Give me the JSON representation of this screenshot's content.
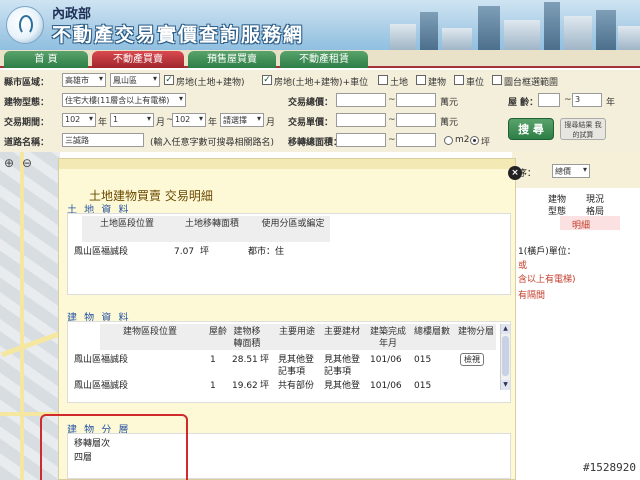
{
  "header": {
    "agency": "內政部",
    "title": "不動產交易實價查詢服務網"
  },
  "nav": {
    "tabs": [
      {
        "label": "首 頁",
        "active": false
      },
      {
        "label": "不動產買賣",
        "active": true
      },
      {
        "label": "預售屋買賣",
        "active": false
      },
      {
        "label": "不動產租賃",
        "active": false
      }
    ]
  },
  "search": {
    "area_label": "縣市區域：",
    "city": "高雄市",
    "district": "鳳山區",
    "check_land": "房地(土地+建物)",
    "check_land_car": "房地(土地+建物)+車位",
    "check_soil": "土地",
    "check_building": "建物",
    "check_car": "車位",
    "check_map": "圖台框選範圍",
    "type_label": "建物型態：",
    "type_value": "住宅大樓(11層含以上有電梯)",
    "total_price_label": "交易總價：",
    "total_unit": "萬元",
    "age_label": "屋 齡：",
    "age_from": "",
    "age_to": "3",
    "age_unit": "年",
    "date_label": "交易期間：",
    "year_from": "102",
    "month_from": "1",
    "year_to": "102",
    "month_to_placeholder": "請選擇",
    "year_unit": "年",
    "month_unit": "月",
    "unit_price_label": "交易單價：",
    "unit_price_unit": "萬元",
    "road_label": "道路名稱：",
    "road_value": "三誠路",
    "road_hint": "(輸入任意字數可搜尋相關路名)",
    "area_size_label": "移轉總面積：",
    "unit_m2": "m2",
    "unit_ping": "坪",
    "search_btn": "搜 尋",
    "calc_btn": "搜尋結果 我的試算",
    "range_sep": "~"
  },
  "map": {
    "zoom_in": "⊕",
    "zoom_out": "⊖"
  },
  "sidebar": {
    "sort_label": "序：",
    "sort_value": "總價",
    "col_building": "建物",
    "col_type": "型態",
    "col_current": "現況",
    "col_layout": "格局",
    "tag": "明細",
    "line1": "1(橫戶)單位：",
    "line2": "或",
    "line3": "含以上有電梯)",
    "line4": "有隔間"
  },
  "modal": {
    "title": "土地建物買賣 交易明細",
    "close": "×",
    "land": {
      "section": "土 地 資 料",
      "headers": [
        "土地區段位置",
        "土地移轉面積",
        "使用分區或編定"
      ],
      "rows": [
        {
          "location": "鳳山區福誠段",
          "area": "7.07",
          "unit": "坪",
          "zone": "都市：住"
        }
      ]
    },
    "building": {
      "section": "建 物 資 料",
      "headers": [
        "建物區段位置",
        "屋齡",
        "建物移轉面積",
        "主要用途",
        "主要建材",
        "建築完成年月",
        "總樓層數",
        "建物分層"
      ],
      "rows": [
        {
          "location": "鳳山區福誠段",
          "age": "1",
          "area": "28.51",
          "unit": "坪",
          "use": "見其他登記事項",
          "material": "見其他登記事項",
          "date": "101/06",
          "floors": "015",
          "action": "檢視"
        },
        {
          "location": "鳳山區福誠段",
          "age": "1",
          "area": "19.62",
          "unit": "坪",
          "use": "共有部份",
          "material": "見其他登",
          "date": "101/06",
          "floors": "015",
          "action": ""
        }
      ]
    },
    "floors": {
      "section": "建 物 分 層",
      "header": "移轉層次",
      "value": "四層"
    }
  },
  "watermark": "#1528920",
  "colors": {
    "accent_green": "#2c7f46",
    "accent_red": "#a0262c",
    "section_blue": "#2a57a6",
    "highlight_red": "#d12a2a"
  }
}
